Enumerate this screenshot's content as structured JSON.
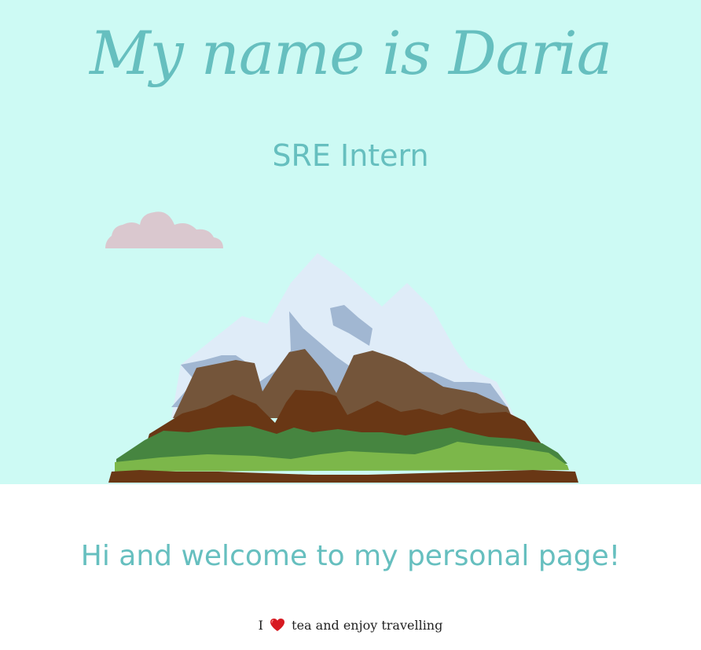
{
  "hero": {
    "title": "My name is Daria",
    "subtitle": "SRE Intern",
    "background_color": "#cdfaf4",
    "accent_color": "#66bfbf",
    "cloud_icon": "cloud-icon",
    "mountain_icon": "mountain-icon"
  },
  "content": {
    "welcome": "Hi and welcome to my personal page!",
    "tagline_prefix": "I",
    "heart_icon": "heart-icon",
    "tagline_suffix": "tea and enjoy travelling"
  }
}
